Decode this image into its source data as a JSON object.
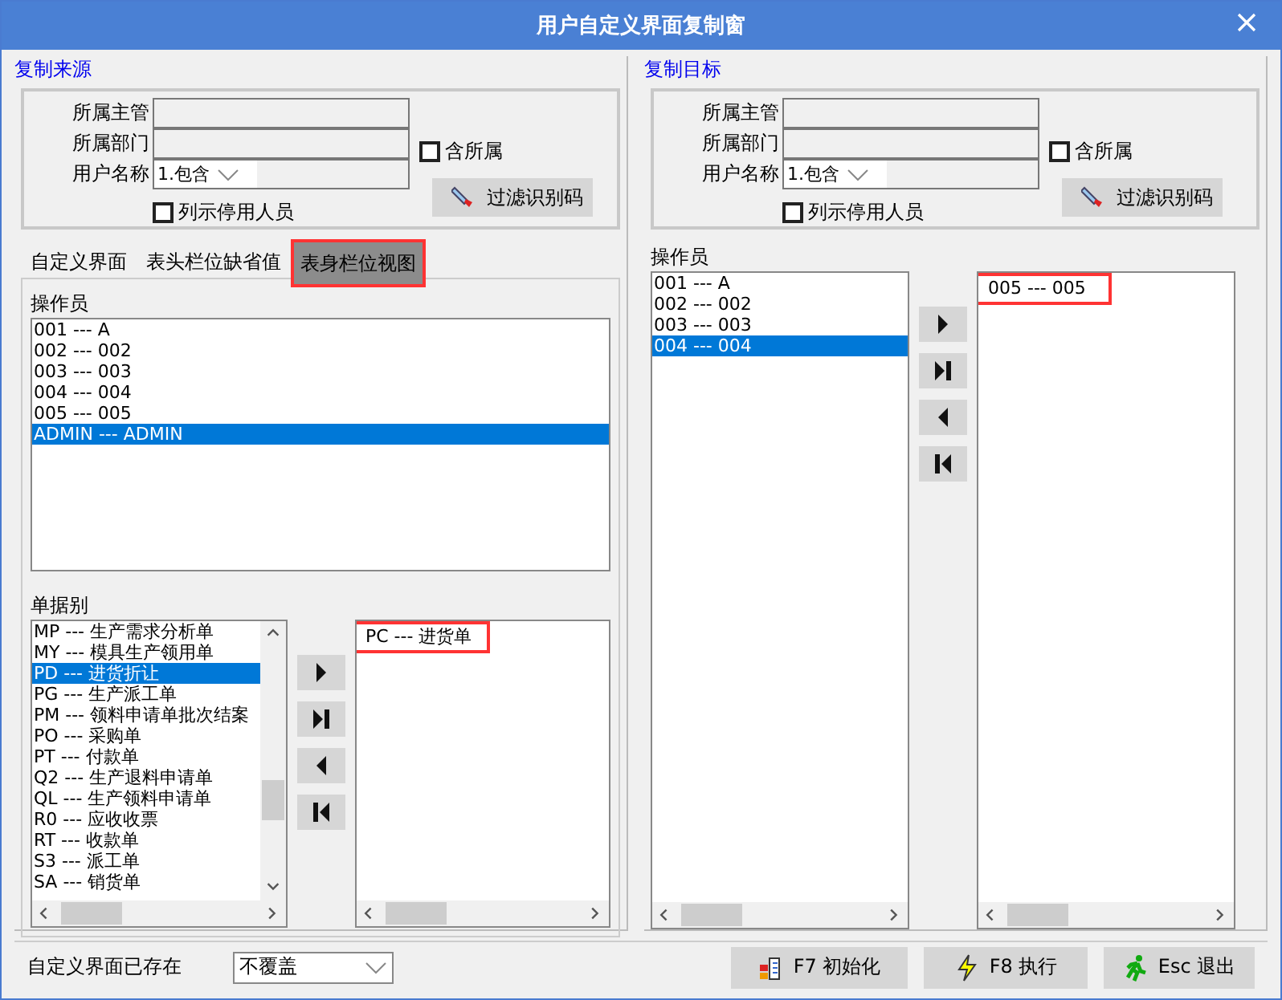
{
  "window": {
    "title": "用户自定义界面复制窗"
  },
  "source": {
    "legend": "复制来源",
    "filter": {
      "supervisor_label": "所属主管",
      "department_label": "所属部门",
      "include_sub": {
        "label": "含所属",
        "checked": false
      },
      "user_label": "用户名称",
      "match_select": "1.包含",
      "filter_button": "过滤识别码",
      "show_disabled": {
        "label": "列示停用人员",
        "checked": false
      }
    },
    "tabs": [
      {
        "label": "自定义界面",
        "selected": false
      },
      {
        "label": "表头栏位缺省值",
        "selected": false
      },
      {
        "label": "表身栏位视图",
        "selected": true,
        "highlighted": true
      }
    ],
    "operators_label": "操作员",
    "operators": [
      {
        "text": "001 --- A",
        "selected": false
      },
      {
        "text": "002 --- 002",
        "selected": false
      },
      {
        "text": "003 --- 003",
        "selected": false
      },
      {
        "text": "004 --- 004",
        "selected": false
      },
      {
        "text": "005 --- 005",
        "selected": false
      },
      {
        "text": "ADMIN --- ADMIN",
        "selected": true
      }
    ],
    "doc_types_label": "单据别",
    "doc_types": [
      {
        "text": "MP --- 生产需求分析单",
        "selected": false
      },
      {
        "text": "MY --- 模具生产领用单",
        "selected": false
      },
      {
        "text": "PD --- 进货折让",
        "selected": true
      },
      {
        "text": "PG --- 生产派工单",
        "selected": false
      },
      {
        "text": "PM --- 领料申请单批次结案",
        "selected": false
      },
      {
        "text": "PO --- 采购单",
        "selected": false
      },
      {
        "text": "PT --- 付款单",
        "selected": false
      },
      {
        "text": "Q2 --- 生产退料申请单",
        "selected": false
      },
      {
        "text": "QL --- 生产领料申请单",
        "selected": false
      },
      {
        "text": "R0 --- 应收收票",
        "selected": false
      },
      {
        "text": "RT --- 收款单",
        "selected": false
      },
      {
        "text": "S3 --- 派工单",
        "selected": false
      },
      {
        "text": "SA --- 销货单",
        "selected": false
      }
    ],
    "chosen_doc_types": [
      {
        "text": "PC --- 进货单",
        "selected": false,
        "highlighted": true
      }
    ]
  },
  "target": {
    "legend": "复制目标",
    "filter": {
      "supervisor_label": "所属主管",
      "department_label": "所属部门",
      "include_sub": {
        "label": "含所属",
        "checked": false
      },
      "user_label": "用户名称",
      "match_select": "1.包含",
      "filter_button": "过滤识别码",
      "show_disabled": {
        "label": "列示停用人员",
        "checked": false
      }
    },
    "operators_label": "操作员",
    "operators": [
      {
        "text": "001 --- A",
        "selected": false
      },
      {
        "text": "002 --- 002",
        "selected": false
      },
      {
        "text": "003 --- 003",
        "selected": false
      },
      {
        "text": "004 --- 004",
        "selected": true
      }
    ],
    "chosen_operators": [
      {
        "text": "005 --- 005",
        "selected": false,
        "highlighted": true
      }
    ]
  },
  "footer": {
    "exists_label": "自定义界面已存在",
    "exists_select": "不覆盖",
    "buttons": [
      {
        "kind": "init",
        "label": "F7 初始化"
      },
      {
        "kind": "run",
        "label": "F8 执行"
      },
      {
        "kind": "exit",
        "label": "Esc 退出"
      }
    ]
  }
}
